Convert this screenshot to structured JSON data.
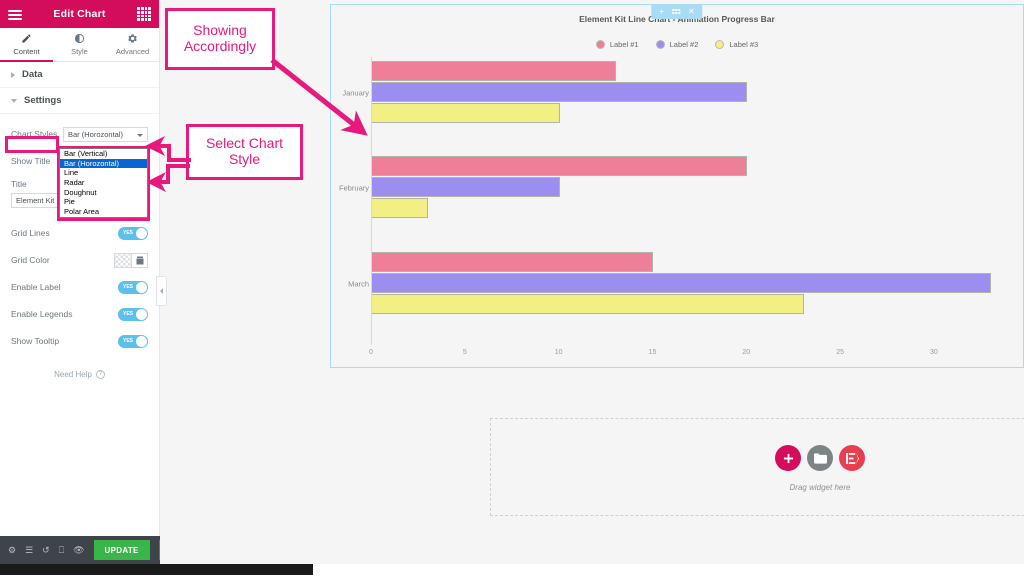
{
  "panel": {
    "header": {
      "title": "Edit Chart",
      "menu_icon": "hamburger-icon",
      "grid_icon": "grid-icon"
    },
    "tabs": [
      {
        "label": "Content",
        "icon": "pencil-icon",
        "active": true
      },
      {
        "label": "Style",
        "icon": "contrast-icon",
        "active": false
      },
      {
        "label": "Advanced",
        "icon": "gear-icon",
        "active": false
      }
    ],
    "sections": [
      {
        "label": "Data",
        "expanded": false
      },
      {
        "label": "Settings",
        "expanded": true
      }
    ],
    "controls": {
      "chart_styles": {
        "label": "Chart Styles",
        "value": "Bar (Horozontal)"
      },
      "show_title": {
        "label": "Show Title",
        "value": "YES"
      },
      "title": {
        "label": "Title",
        "value": "Element Kit",
        "placeholder": "Title"
      },
      "grid_lines": {
        "label": "Grid Lines",
        "value": "YES"
      },
      "grid_color": {
        "label": "Grid Color"
      },
      "enable_label": {
        "label": "Enable Label",
        "value": "YES"
      },
      "enable_legends": {
        "label": "Enable Legends",
        "value": "YES"
      },
      "show_tooltip": {
        "label": "Show Tooltip",
        "value": "YES"
      }
    },
    "dropdown_options": [
      "Bar (Vertical)",
      "Bar (Horozontal)",
      "Line",
      "Radar",
      "Doughnut",
      "Pie",
      "Polar Area"
    ],
    "dropdown_selected_index": 1,
    "need_help": {
      "label": "Need Help",
      "icon": "question-mark-icon"
    },
    "footer": {
      "icons": [
        "gear-icon",
        "layers-icon",
        "history-icon",
        "responsive-icon",
        "preview-icon"
      ],
      "update_label": "UPDATE",
      "arrow_icon": "chevron-up-icon"
    }
  },
  "canvas": {
    "widget_toolbar": {
      "add_icon": "plus-icon",
      "drag_icon": "drag-handle-icon",
      "close_icon": "close-icon"
    },
    "drop_area": {
      "label": "Drag widget here",
      "buttons": [
        {
          "name": "add-widget",
          "glyph": "+"
        },
        {
          "name": "add-template",
          "glyph": "folder"
        },
        {
          "name": "elementskit",
          "glyph": "EK"
        }
      ]
    }
  },
  "annotations": [
    {
      "id": "showing-accordingly",
      "text": "Showing Accordingly"
    },
    {
      "id": "select-chart-style",
      "text": "Select Chart Style"
    }
  ],
  "chart_data": {
    "type": "bar",
    "orientation": "horizontal",
    "title": "Element Kit Line Chart - Animation Progress Bar",
    "xlabel": "",
    "ylabel": "",
    "categories": [
      "January",
      "February",
      "March"
    ],
    "series": [
      {
        "name": "Label #1",
        "color": "#ed7f98",
        "values": [
          13,
          20,
          15
        ]
      },
      {
        "name": "Label #2",
        "color": "#9b8ef0",
        "values": [
          20,
          10,
          33
        ]
      },
      {
        "name": "Label #3",
        "color": "#f2ef85",
        "values": [
          10,
          3,
          23
        ]
      }
    ],
    "xticks": [
      0,
      5,
      10,
      15,
      20,
      25,
      30
    ],
    "xlim": [
      0,
      34
    ],
    "grid": false,
    "legend_position": "top"
  }
}
